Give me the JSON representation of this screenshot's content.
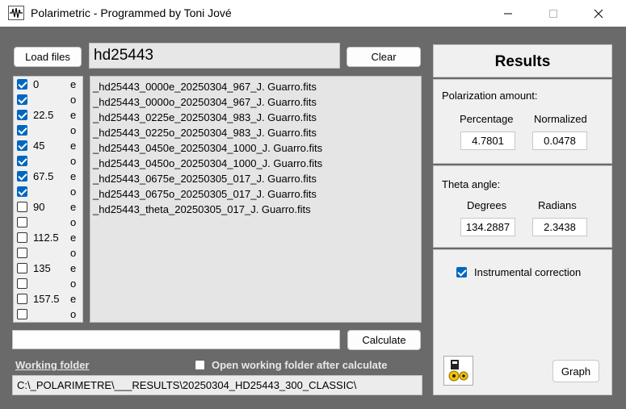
{
  "window": {
    "title": "Polarimetric - Programmed by Toni Jové",
    "minimize_icon": "minimize-icon",
    "maximize_icon": "maximize-icon",
    "close_icon": "close-icon"
  },
  "toolbar": {
    "load_label": "Load files",
    "object_name": "hd25443",
    "clear_label": "Clear",
    "calculate_label": "Calculate",
    "calc_field": ""
  },
  "angles": [
    {
      "angle": "0",
      "e": true,
      "o": true
    },
    {
      "angle": "22.5",
      "e": true,
      "o": true
    },
    {
      "angle": "45",
      "e": true,
      "o": true
    },
    {
      "angle": "67.5",
      "e": true,
      "o": true
    },
    {
      "angle": "90",
      "e": false,
      "o": false
    },
    {
      "angle": "112.5",
      "e": false,
      "o": false
    },
    {
      "angle": "135",
      "e": false,
      "o": false
    },
    {
      "angle": "157.5",
      "e": false,
      "o": false
    }
  ],
  "eo_labels": {
    "e": "e",
    "o": "o"
  },
  "files": [
    "_hd25443_0000e_20250304_967_J. Guarro.fits",
    "_hd25443_0000o_20250304_967_J. Guarro.fits",
    "_hd25443_0225e_20250304_983_J. Guarro.fits",
    "_hd25443_0225o_20250304_983_J. Guarro.fits",
    "_hd25443_0450e_20250304_1000_J. Guarro.fits",
    "_hd25443_0450o_20250304_1000_J. Guarro.fits",
    "_hd25443_0675e_20250305_017_J. Guarro.fits",
    "_hd25443_0675o_20250305_017_J. Guarro.fits",
    "_hd25443_theta_20250305_017_J. Guarro.fits"
  ],
  "results": {
    "title": "Results",
    "polarization_label": "Polarization amount:",
    "percentage_label": "Percentage",
    "normalized_label": "Normalized",
    "percentage": "4.7801",
    "normalized": "0.0478",
    "theta_label": "Theta angle:",
    "degrees_label": "Degrees",
    "radians_label": "Radians",
    "degrees": "134.2887",
    "radians": "2.3438",
    "instrumental_label": "Instrumental correction",
    "instrumental_checked": true,
    "graph_label": "Graph",
    "settings_icon": "gears-icon"
  },
  "footer": {
    "working_folder_label": "Working folder",
    "open_after_label": "Open working folder after calculate",
    "open_after_checked": false,
    "path": "C:\\_POLARIMETRE\\___RESULTS\\20250304_HD25443_300_CLASSIC\\"
  },
  "colors": {
    "accent": "#0067c0",
    "frame": "#6a6a6a",
    "panel": "#f0f0f0"
  }
}
